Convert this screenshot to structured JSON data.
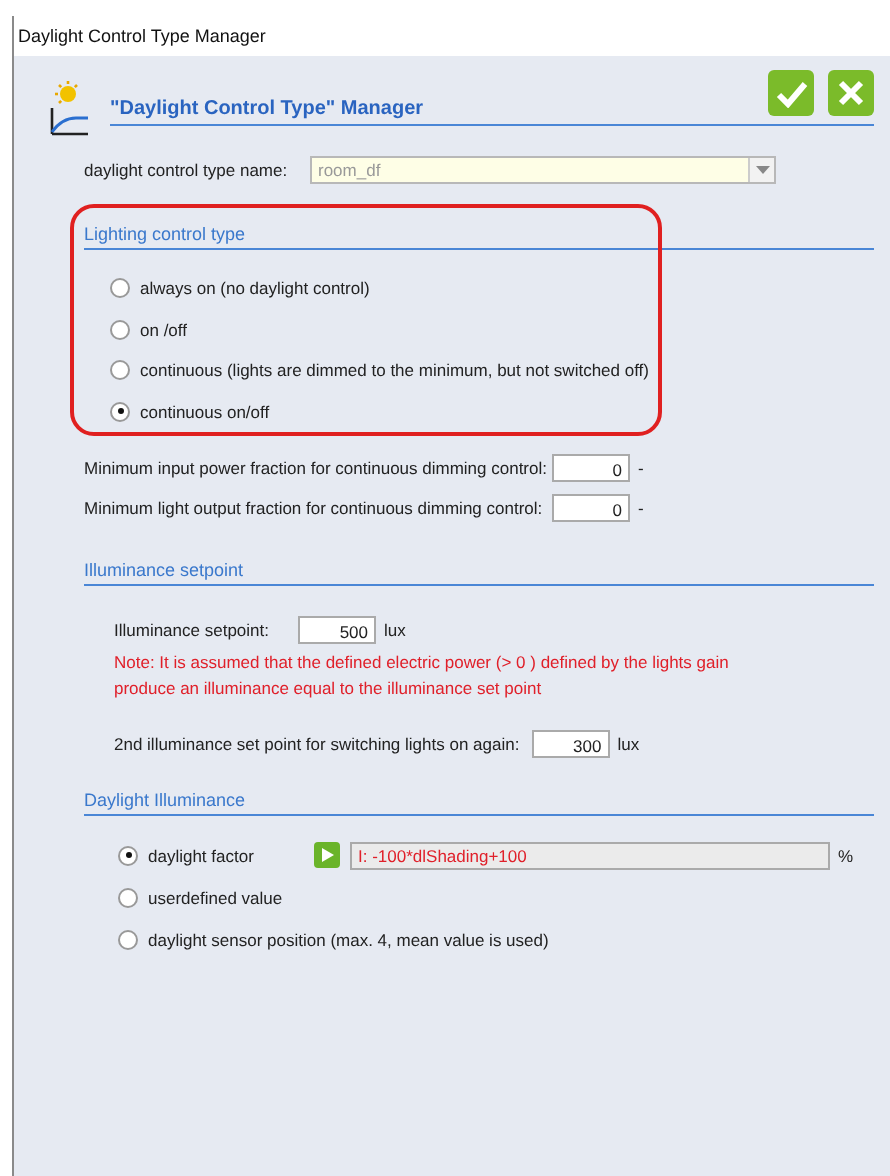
{
  "window": {
    "title": "Daylight Control Type Manager"
  },
  "header": {
    "title": "\"Daylight Control Type\" Manager"
  },
  "name_field": {
    "label": "daylight control type name:",
    "value": "room_df"
  },
  "lighting_control_type": {
    "title": "Lighting control type",
    "options": [
      {
        "label": "always on (no daylight control)",
        "selected": false
      },
      {
        "label": "on /off",
        "selected": false
      },
      {
        "label": "continuous (lights are dimmed to the minimum, but not switched off)",
        "selected": false
      },
      {
        "label": "continuous on/off",
        "selected": true
      }
    ]
  },
  "fractions": [
    {
      "label": "Minimum input power fraction for continuous dimming control:",
      "value": "0",
      "unit": "-"
    },
    {
      "label": "Minimum light output fraction for continuous dimming control:",
      "value": "0",
      "unit": "-"
    }
  ],
  "illuminance_setpoint": {
    "title": "Illuminance setpoint",
    "setpoint": {
      "label": "Illuminance setpoint:",
      "value": "500",
      "unit": "lux"
    },
    "note": "Note: It is assumed that the defined electric power (> 0 ) defined by the lights gain produce an illuminance equal to the illuminance set point",
    "second": {
      "label": "2nd illuminance set point for switching lights on again:",
      "value": "300",
      "unit": "lux"
    }
  },
  "daylight_illuminance": {
    "title": "Daylight Illuminance",
    "options": [
      {
        "label": "daylight factor",
        "selected": true,
        "formula": "I: -100*dlShading+100",
        "unit": "%"
      },
      {
        "label": "userdefined value",
        "selected": false
      },
      {
        "label": "daylight sensor position (max. 4, mean value is used)",
        "selected": false
      }
    ]
  }
}
